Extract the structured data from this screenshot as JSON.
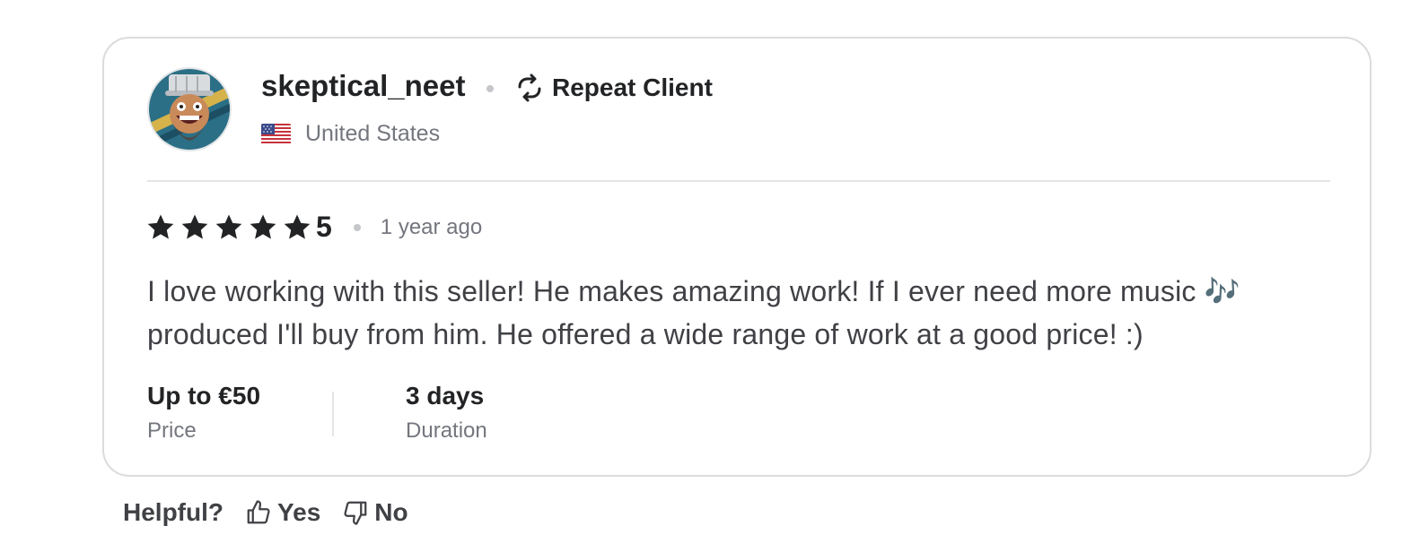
{
  "review": {
    "user": {
      "username": "skeptical_neet",
      "badge_label": "Repeat Client",
      "badge_icon": "repeat-icon",
      "country": "United States",
      "flag_icon": "us-flag-icon",
      "avatar_icon": "avatar-image"
    },
    "rating": {
      "stars": 5,
      "value": "5",
      "time_ago": "1 year ago"
    },
    "text": "I love working with this seller! He makes amazing work! If I ever need more music 🎶 produced I'll buy from him. He offered a wide range of work at a good price! :)",
    "meta": {
      "price_value": "Up to €50",
      "price_label": "Price",
      "duration_value": "3 days",
      "duration_label": "Duration"
    }
  },
  "helpful": {
    "label": "Helpful?",
    "yes_label": "Yes",
    "no_label": "No"
  },
  "colors": {
    "text_primary": "#222325",
    "text_secondary": "#74767e",
    "border": "#dadbdd",
    "star": "#222325"
  }
}
